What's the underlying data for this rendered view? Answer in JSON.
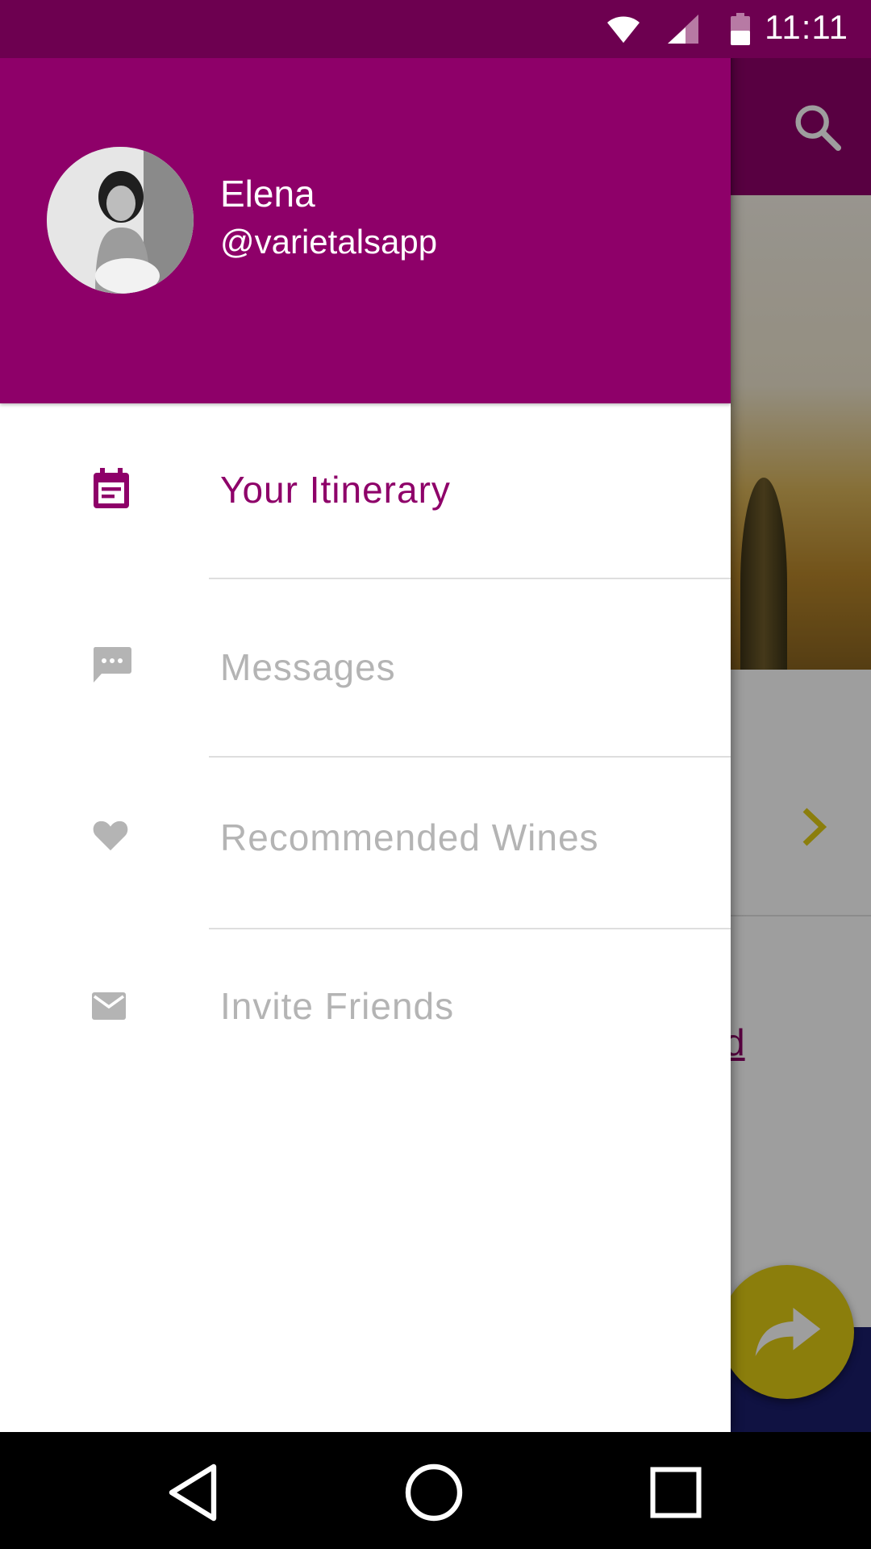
{
  "status_bar": {
    "time": "11:11",
    "icons": [
      "wifi-icon",
      "cellular-signal-icon",
      "battery-icon"
    ]
  },
  "drawer": {
    "profile": {
      "name": "Elena",
      "handle": "@varietalsapp",
      "avatar_icon": "profile-photo"
    },
    "items": [
      {
        "label": "Your Itinerary",
        "icon": "calendar-icon",
        "active": true
      },
      {
        "label": "Messages",
        "icon": "message-icon",
        "active": false
      },
      {
        "label": "Recommended Wines",
        "icon": "heart-icon",
        "active": false
      },
      {
        "label": "Invite Friends",
        "icon": "mail-icon",
        "active": false
      }
    ]
  },
  "background_app": {
    "partial_link_text": "d",
    "fab_icon": "share-icon",
    "toolbar_icon": "search-icon",
    "chevron_icon": "chevron-right-icon"
  },
  "navigation_bar": {
    "buttons": [
      "back-icon",
      "home-icon",
      "recents-icon"
    ]
  },
  "colors": {
    "primary": "#8e0069",
    "status_bar": "#6d0050",
    "accent": "#e0cc14",
    "inactive_text": "#b4b4b4"
  }
}
